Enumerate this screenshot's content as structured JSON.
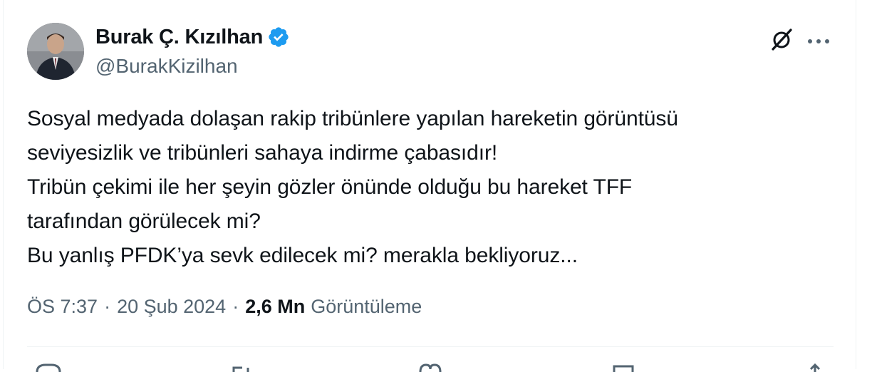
{
  "author": {
    "display_name": "Burak Ç. Kızılhan",
    "handle": "@BurakKizilhan",
    "verified": true
  },
  "tweet": {
    "lines": [
      "Sosyal medyada dolaşan rakip tribünlere yapılan hareketin görüntüsü",
      "seviyesizlik ve tribünleri sahaya indirme çabasıdır!",
      "Tribün çekimi ile her şeyin gözler önünde olduğu bu hareket TFF",
      "tarafından görülecek mi?",
      "Bu yanlış PFDK’ya sevk edilecek mi? merakla bekliyoruz..."
    ]
  },
  "meta": {
    "time": "ÖS 7:37",
    "separator": "·",
    "date": "20 Şub 2024",
    "views_count": "2,6 Mn",
    "views_label": "Görüntüleme"
  },
  "icons": {
    "verified": "verified-badge-icon",
    "grok": "grok-icon",
    "more": "more-icon",
    "reply": "reply-icon",
    "repost": "repost-icon",
    "like": "like-icon",
    "bookmark": "bookmark-icon",
    "share": "share-icon"
  },
  "colors": {
    "text": "#0f1419",
    "secondary": "#536471",
    "verified_blue": "#1d9bf0",
    "divider": "#eff3f4"
  }
}
